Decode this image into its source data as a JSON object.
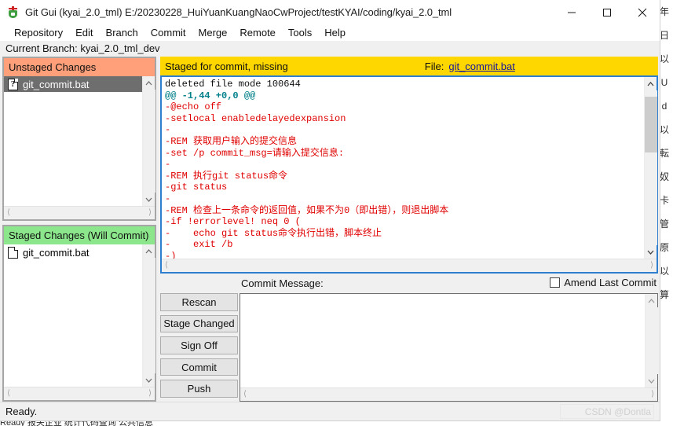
{
  "window": {
    "title": "Git Gui (kyai_2.0_tml) E:/20230228_HuiYuanKuangNaoCwProject/testKYAI/coding/kyai_2.0_tml",
    "icon": "git-gui-icon",
    "controls": {
      "minimize": "minimize-icon",
      "maximize": "maximize-icon",
      "close": "close-icon"
    }
  },
  "menubar": {
    "items": [
      {
        "label": "Repository"
      },
      {
        "label": "Edit"
      },
      {
        "label": "Branch"
      },
      {
        "label": "Commit"
      },
      {
        "label": "Merge"
      },
      {
        "label": "Remote"
      },
      {
        "label": "Tools"
      },
      {
        "label": "Help"
      }
    ]
  },
  "branchbar": {
    "text": "Current Branch: kyai_2.0_tml_dev"
  },
  "unstaged": {
    "header": "Unstaged Changes",
    "header_color": "#ffa07a",
    "files": [
      {
        "name": "git_commit.bat",
        "icon": "question-file-icon",
        "selected": true
      }
    ]
  },
  "staged": {
    "header": "Staged Changes (Will Commit)",
    "header_color": "#8ce68c",
    "files": [
      {
        "name": "git_commit.bat",
        "icon": "file-icon",
        "selected": false
      }
    ]
  },
  "diff": {
    "status": "Staged for commit, missing",
    "file_label": "File:",
    "file_name": "git_commit.bat",
    "header_color": "#ffd700",
    "link_color": "#16169b",
    "lines": [
      {
        "kind": "plain",
        "text": "deleted file mode 100644"
      },
      {
        "kind": "hunk",
        "text": "@@ -1,44 +0,0 @@"
      },
      {
        "kind": "del",
        "text": "-@echo off"
      },
      {
        "kind": "del",
        "text": "-setlocal enabledelayedexpansion"
      },
      {
        "kind": "del",
        "text": "-"
      },
      {
        "kind": "del",
        "text": "-REM 获取用户输入的提交信息"
      },
      {
        "kind": "del",
        "text": "-set /p commit_msg=请输入提交信息:"
      },
      {
        "kind": "del",
        "text": "-"
      },
      {
        "kind": "del",
        "text": "-REM 执行git status命令"
      },
      {
        "kind": "del",
        "text": "-git status"
      },
      {
        "kind": "del",
        "text": "-"
      },
      {
        "kind": "del",
        "text": "-REM 检查上一条命令的返回值，如果不为0（即出错），则退出脚本"
      },
      {
        "kind": "del",
        "text": "-if !errorlevel! neq 0 ("
      },
      {
        "kind": "del",
        "text": "-    echo git status命令执行出错，脚本终止"
      },
      {
        "kind": "del",
        "text": "-    exit /b"
      },
      {
        "kind": "del",
        "text": "-)"
      },
      {
        "kind": "del",
        "text": "-"
      }
    ],
    "scroll": {
      "thumb_top_pct": 4,
      "thumb_height_pct": 36
    }
  },
  "commit": {
    "message_label": "Commit Message:",
    "amend_label": "Amend Last Commit",
    "amend_checked": false,
    "message_value": "",
    "buttons": [
      {
        "label": "Rescan"
      },
      {
        "label": "Stage Changed"
      },
      {
        "label": "Sign Off"
      },
      {
        "label": "Commit"
      },
      {
        "label": "Push"
      }
    ]
  },
  "statusbar": {
    "text": "Ready.",
    "watermark": "CSDN @Dontla"
  },
  "background": {
    "right_column": [
      "年",
      "日",
      "以",
      "U",
      "d",
      "以",
      "転",
      "奴",
      "卡",
      "管",
      "原",
      "以",
      "算"
    ],
    "bottom_text": "Ready  报关企业  统计代码查询  公共信息"
  }
}
